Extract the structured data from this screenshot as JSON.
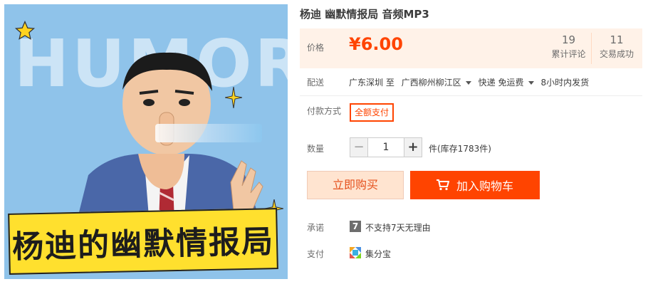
{
  "product": {
    "title": "杨迪 幽默情报局 音频MP3",
    "image": {
      "background_word": "HUMOR",
      "banner_text": "杨迪的幽默情报局"
    }
  },
  "price": {
    "label": "价格",
    "value": "¥6.00",
    "color": "#ff4400"
  },
  "stats": {
    "reviews": {
      "count": "19",
      "label": "累计评论"
    },
    "trades": {
      "count": "11",
      "label": "交易成功"
    }
  },
  "shipping": {
    "label": "配送",
    "from": "广东深圳 至",
    "to": "广西柳州柳江区",
    "method": "快递 免运费",
    "dispatch": "8小时内发货"
  },
  "payment_type": {
    "label": "付款方式",
    "option": "全额支付"
  },
  "quantity": {
    "label": "数量",
    "minus": "−",
    "value": "1",
    "plus": "+",
    "stock": "件(库存1783件)"
  },
  "actions": {
    "buy_now": "立即购买",
    "add_to_cart": "加入购物车"
  },
  "promise": {
    "label": "承诺",
    "icon_text": "7",
    "text": "不支持7天无理由"
  },
  "pay_method": {
    "label": "支付",
    "text": "集分宝"
  },
  "colors": {
    "accent": "#ff4400",
    "price_bg": "#fff2e8",
    "buy_bg": "#ffe4d0"
  }
}
